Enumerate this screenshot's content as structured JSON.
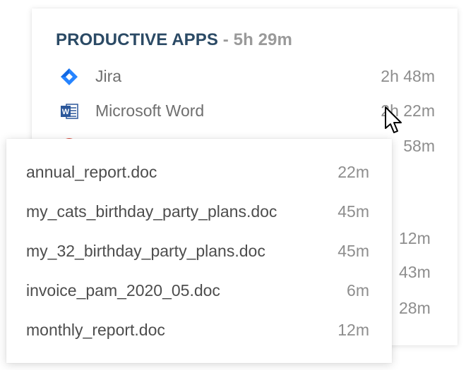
{
  "productive_apps": {
    "title": "PRODUCTIVE APPS",
    "separator": " - ",
    "total": "5h 29m",
    "items": [
      {
        "label": "Jira",
        "time": "2h 48m",
        "icon": "jira-icon"
      },
      {
        "label": "Microsoft Word",
        "time": "2h 22m",
        "icon": "word-icon"
      },
      {
        "label": "",
        "time": "58m",
        "icon": "chrome-icon"
      }
    ],
    "partial_times": [
      "12m",
      "43m",
      "28m"
    ]
  },
  "documents": {
    "items": [
      {
        "name": "annual_report.doc",
        "time": "22m"
      },
      {
        "name": "my_cats_birthday_party_plans.doc",
        "time": "45m"
      },
      {
        "name": "my_32_birthday_party_plans.doc",
        "time": "45m"
      },
      {
        "name": "invoice_pam_2020_05.doc",
        "time": "6m"
      },
      {
        "name": "monthly_report.doc",
        "time": "12m"
      }
    ]
  },
  "colors": {
    "title": "#2b4a65",
    "jira": "#2684ff",
    "word": "#2b579a",
    "chrome": "#db4437"
  }
}
